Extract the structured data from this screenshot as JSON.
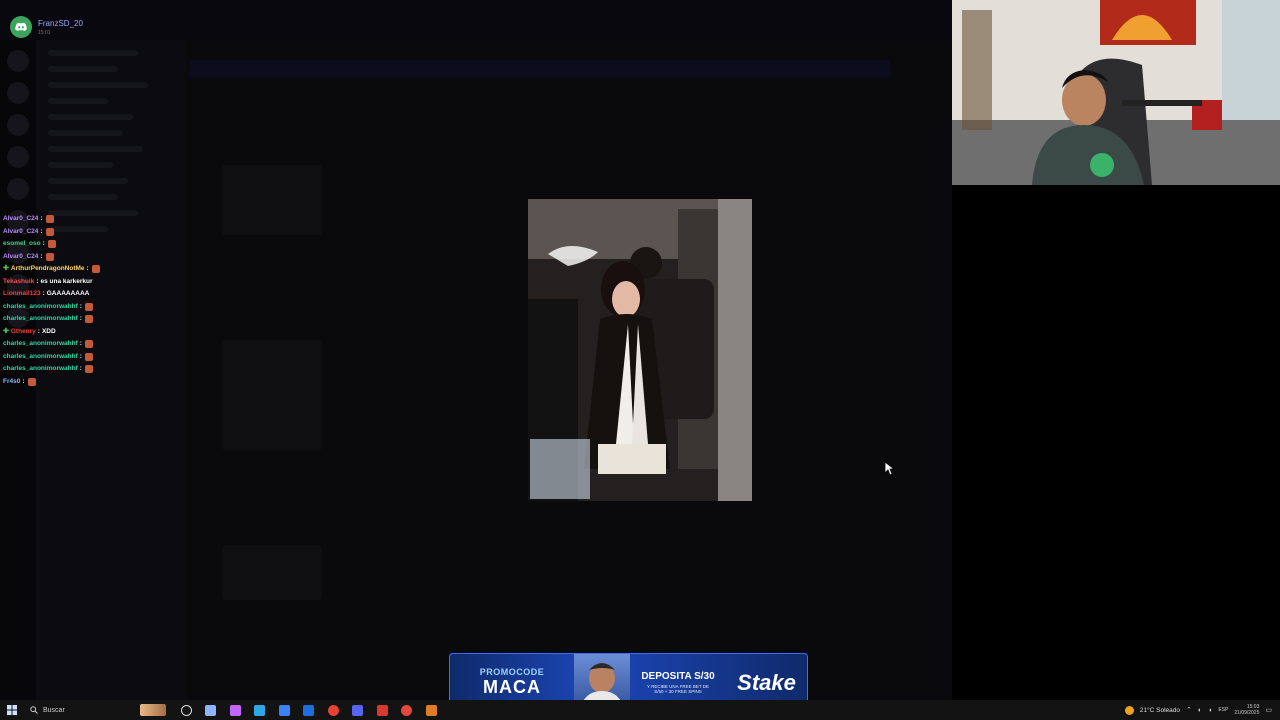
{
  "discord_notification": {
    "username": "FranzSD_20",
    "time": "15:01"
  },
  "chat": [
    {
      "user": "Alvar0_C24",
      "color": "#b98aff",
      "msg": "",
      "emote": true,
      "badge": false
    },
    {
      "user": "Alvar0_C24",
      "color": "#b98aff",
      "msg": "",
      "emote": true,
      "badge": false
    },
    {
      "user": "esomel_oso",
      "color": "#39d08f",
      "msg": "",
      "emote": true,
      "badge": false
    },
    {
      "user": "Alvar0_C24",
      "color": "#b98aff",
      "msg": "",
      "emote": true,
      "badge": false
    },
    {
      "user": "ArthurPendragonNotMe",
      "color": "#ffd36b",
      "msg": "",
      "emote": true,
      "badge": true
    },
    {
      "user": "Tekashuik",
      "color": "#ff4d4d",
      "msg": "es una karkerkur",
      "emote": false,
      "badge": false
    },
    {
      "user": "Lionmail123",
      "color": "#ff3a3a",
      "msg": "GAAAAAAAA",
      "emote": false,
      "badge": false
    },
    {
      "user": "charles_anonimorwahhf",
      "color": "#2fd6a0",
      "msg": "",
      "emote": true,
      "badge": false
    },
    {
      "user": "charles_anonimorwahhf",
      "color": "#2fd6a0",
      "msg": "",
      "emote": true,
      "badge": false
    },
    {
      "user": "Gthenry",
      "color": "#ff3a3a",
      "msg": "XDD",
      "emote": false,
      "badge": true
    },
    {
      "user": "charles_anonimorwahhf",
      "color": "#2fd6a0",
      "msg": "",
      "emote": true,
      "badge": false
    },
    {
      "user": "charles_anonimorwahhf",
      "color": "#2fd6a0",
      "msg": "",
      "emote": true,
      "badge": false
    },
    {
      "user": "charles_anonimorwahhf",
      "color": "#2fd6a0",
      "msg": "",
      "emote": true,
      "badge": false
    },
    {
      "user": "Fr4s0",
      "color": "#8fb8ff",
      "msg": "",
      "emote": true,
      "badge": false
    }
  ],
  "banner": {
    "promo_label": "PROMOCODE",
    "promo_code": "MACA",
    "deposit_title": "DEPOSITA S/30",
    "deposit_sub": "Y RECIBE UNA FREE BET DE",
    "deposit_sub2": "S/50 + 30 FREE SPINS",
    "brand": "Stake"
  },
  "taskbar": {
    "search_placeholder": "Buscar",
    "icons": [
      {
        "name": "circle-icon",
        "color": "#dddddd"
      },
      {
        "name": "task-view-icon",
        "color": "#8fb3ff"
      },
      {
        "name": "copilot-icon",
        "color": "#c266ff"
      },
      {
        "name": "edge-icon",
        "color": "#2fa8e8"
      },
      {
        "name": "store-icon",
        "color": "#3b82f6"
      },
      {
        "name": "outlook-icon",
        "color": "#1e6fd9"
      },
      {
        "name": "chrome-icon",
        "color": "#e94235"
      },
      {
        "name": "discord-icon",
        "color": "#5865f2"
      },
      {
        "name": "app-red-icon",
        "color": "#d93a2f"
      },
      {
        "name": "app-circle-icon",
        "color": "#e04a3a"
      },
      {
        "name": "obs-icon",
        "color": "#e07b2a"
      }
    ],
    "weather": "21°C  Soleado",
    "lang": "ESP",
    "time": "15:03",
    "date": "21/09/2025"
  }
}
